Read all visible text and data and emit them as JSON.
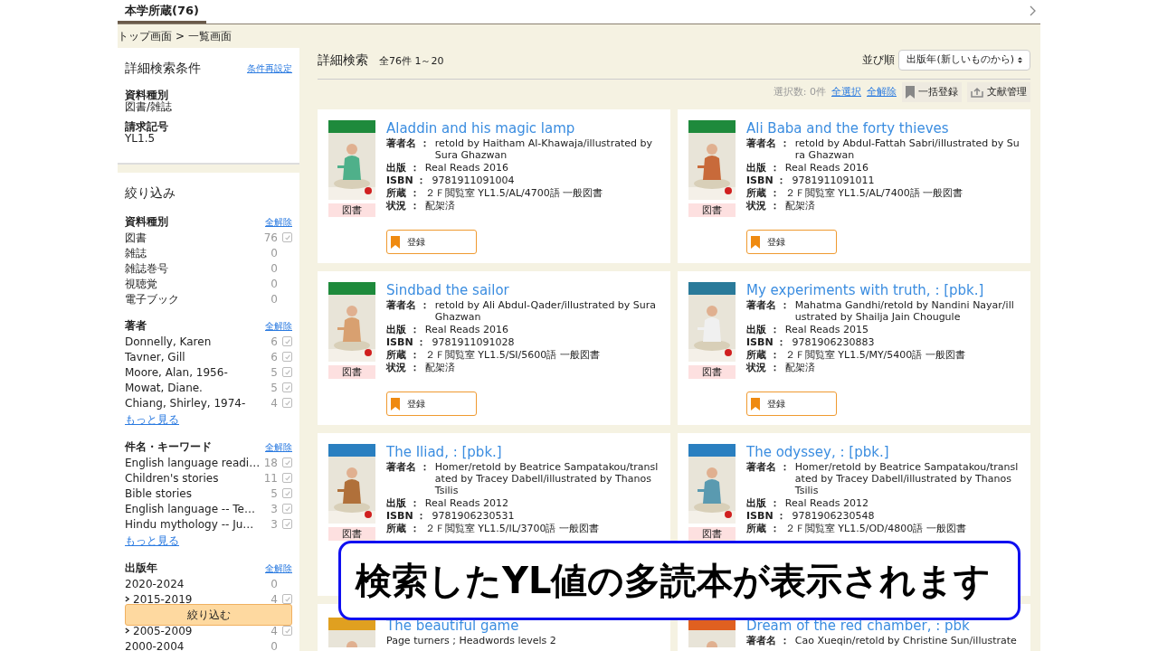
{
  "tab": {
    "label": "本学所蔵(76)",
    "selected": true
  },
  "breadcrumb": {
    "items": [
      "トップ画面",
      "一覧画面"
    ],
    "separator": ">"
  },
  "conditions": {
    "title": "詳細検索条件",
    "reset": "条件再設定",
    "items": [
      {
        "label": "資料種別",
        "value": "図書/雑誌"
      },
      {
        "label": "請求記号",
        "value": "YL1.5"
      }
    ]
  },
  "refine": {
    "title": "絞り込み",
    "button": "絞り込む",
    "groups": [
      {
        "title": "資料種別",
        "clear": "全解除",
        "items": [
          {
            "name": "図書",
            "count": "76",
            "checkbox": true,
            "checked": false
          },
          {
            "name": "雑誌",
            "count": "0",
            "checkbox": false
          },
          {
            "name": "雑誌巻号",
            "count": "0",
            "checkbox": false
          },
          {
            "name": "視聴覚",
            "count": "0",
            "checkbox": false
          },
          {
            "name": "電子ブック",
            "count": "0",
            "checkbox": false
          }
        ]
      },
      {
        "title": "著者",
        "clear": "全解除",
        "more": "もっと見る",
        "items": [
          {
            "name": "Donnelly, Karen",
            "count": "6",
            "checkbox": true,
            "checked": false
          },
          {
            "name": "Tavner, Gill",
            "count": "6",
            "checkbox": true,
            "checked": false
          },
          {
            "name": "Moore, Alan, 1956-",
            "count": "5",
            "checkbox": true,
            "checked": false
          },
          {
            "name": "Mowat, Diane.",
            "count": "5",
            "checkbox": true,
            "checked": false
          },
          {
            "name": "Chiang, Shirley, 1974-",
            "count": "4",
            "checkbox": true,
            "checked": false
          }
        ]
      },
      {
        "title": "件名・キーワード",
        "clear": "全解除",
        "more": "もっと見る",
        "items": [
          {
            "name": "English language readi…",
            "count": "18",
            "checkbox": true,
            "checked": false
          },
          {
            "name": "Children's stories",
            "count": "11",
            "checkbox": true,
            "checked": false
          },
          {
            "name": "Bible stories",
            "count": "5",
            "checkbox": true,
            "checked": false
          },
          {
            "name": "English language -- Te…",
            "count": "3",
            "checkbox": true,
            "checked": false
          },
          {
            "name": "Hindu mythology -- Ju…",
            "count": "3",
            "checkbox": true,
            "checked": false
          }
        ]
      },
      {
        "title": "出版年",
        "clear": "全解除",
        "items": [
          {
            "name": "2020-2024",
            "count": "0",
            "checkbox": false
          },
          {
            "name": "2015-2019",
            "count": "4",
            "checkbox": true,
            "checked": false,
            "expandable": true
          },
          {
            "name": "2005-2009",
            "count": "4",
            "checkbox": true,
            "checked": false,
            "expandable": true
          },
          {
            "name": "2000-2004",
            "count": "0",
            "checkbox": false
          }
        ]
      }
    ]
  },
  "results": {
    "title": "詳細検索",
    "summary": "全76件 1～20",
    "sort_label": "並び順",
    "sort_value": "出版年(新しいものから)",
    "selected_count": "選択数: 0件",
    "select_all": "全選択",
    "clear_all": "全解除",
    "bulk_register": "一括登録",
    "reference_manager": "文献管理",
    "books": [
      {
        "title": "Aladdin and his magic lamp",
        "type": "図書",
        "fields": [
          {
            "kind": "field",
            "label": "著者名 ：",
            "value": "retold by Haitham Al-Khawaja/illustrated by Sura Ghazwan"
          },
          {
            "kind": "field",
            "label": "出版 ：",
            "value": "Real Reads 2016"
          },
          {
            "kind": "field",
            "label": "ISBN ：",
            "value": "9781911091004"
          },
          {
            "kind": "field",
            "label": "所蔵 ：",
            "value": "２Ｆ閲覧室 YL1.5/AL/4700語 一般図書"
          },
          {
            "kind": "field",
            "label": "状況 ：",
            "value": "配架済"
          }
        ],
        "button": "登録"
      },
      {
        "title": "Ali Baba and the forty thieves",
        "type": "図書",
        "fields": [
          {
            "kind": "field",
            "label": "著者名 ：",
            "value": "retold by Abdul-Fattah Sabri/illustrated by Sura Ghazwan"
          },
          {
            "kind": "field",
            "label": "出版 ：",
            "value": "Real Reads 2016"
          },
          {
            "kind": "field",
            "label": "ISBN ：",
            "value": "9781911091011"
          },
          {
            "kind": "field",
            "label": "所蔵 ：",
            "value": "２Ｆ閲覧室 YL1.5/AL/7400語 一般図書"
          },
          {
            "kind": "field",
            "label": "状況 ：",
            "value": "配架済"
          }
        ],
        "button": "登録"
      },
      {
        "title": "Sindbad the sailor",
        "type": "図書",
        "fields": [
          {
            "kind": "field",
            "label": "著者名 ：",
            "value": "retold by Ali Abdul-Qader/illustrated by Sura Ghazwan"
          },
          {
            "kind": "field",
            "label": "出版 ：",
            "value": "Real Reads 2016"
          },
          {
            "kind": "field",
            "label": "ISBN ：",
            "value": "9781911091028"
          },
          {
            "kind": "field",
            "label": "所蔵 ：",
            "value": "２Ｆ閲覧室 YL1.5/SI/5600語 一般図書"
          },
          {
            "kind": "field",
            "label": "状況 ：",
            "value": "配架済"
          }
        ],
        "button": "登録"
      },
      {
        "title": "My experiments with truth, : [pbk.]",
        "type": "図書",
        "fields": [
          {
            "kind": "field",
            "label": "著者名 ：",
            "value": "Mahatma Gandhi/retold by Nandini Nayar/illustrated by Shailja Jain Chougule"
          },
          {
            "kind": "field",
            "label": "出版 ：",
            "value": "Real Reads 2015"
          },
          {
            "kind": "field",
            "label": "ISBN ：",
            "value": "9781906230883"
          },
          {
            "kind": "field",
            "label": "所蔵 ：",
            "value": "２Ｆ閲覧室 YL1.5/MY/5400語 一般図書"
          },
          {
            "kind": "field",
            "label": "状況 ：",
            "value": "配架済"
          }
        ],
        "button": "登録"
      },
      {
        "title": "The Iliad, : [pbk.]",
        "type": "図書",
        "fields": [
          {
            "kind": "field",
            "label": "著者名 ：",
            "value": "Homer/retold by Beatrice Sampatakou/translated by Tracey Dabell/illustrated by Thanos Tsilis"
          },
          {
            "kind": "field",
            "label": "出版 ：",
            "value": "Real Reads 2012"
          },
          {
            "kind": "field",
            "label": "ISBN ：",
            "value": "9781906230531"
          },
          {
            "kind": "field",
            "label": "所蔵 ：",
            "value": "２Ｆ閲覧室 YL1.5/IL/3700語 一般図書"
          }
        ]
      },
      {
        "title": "The odyssey, : [pbk.]",
        "type": "図書",
        "fields": [
          {
            "kind": "field",
            "label": "著者名 ：",
            "value": "Homer/retold by Beatrice Sampatakou/translated by Tracey Dabell/illustrated by Thanos Tsilis"
          },
          {
            "kind": "field",
            "label": "出版 ：",
            "value": "Real Reads 2012"
          },
          {
            "kind": "field",
            "label": "ISBN ：",
            "value": "9781906230548"
          },
          {
            "kind": "field",
            "label": "所蔵 ：",
            "value": "２Ｆ閲覧室 YL1.5/OD/4800語 一般図書"
          }
        ]
      },
      {
        "title": "The beautiful game",
        "fields": [
          {
            "kind": "note",
            "value": "Page turners ; Headwords levels 2"
          }
        ]
      },
      {
        "title": "Dream of the red chamber, : pbk",
        "fields": [
          {
            "kind": "field",
            "label": "著者名 ：",
            "value": "Cao Xueqin/retold by Christine Sun/illustrate"
          }
        ]
      }
    ]
  },
  "callout": "検索したYL値の多読本が表示されます"
}
